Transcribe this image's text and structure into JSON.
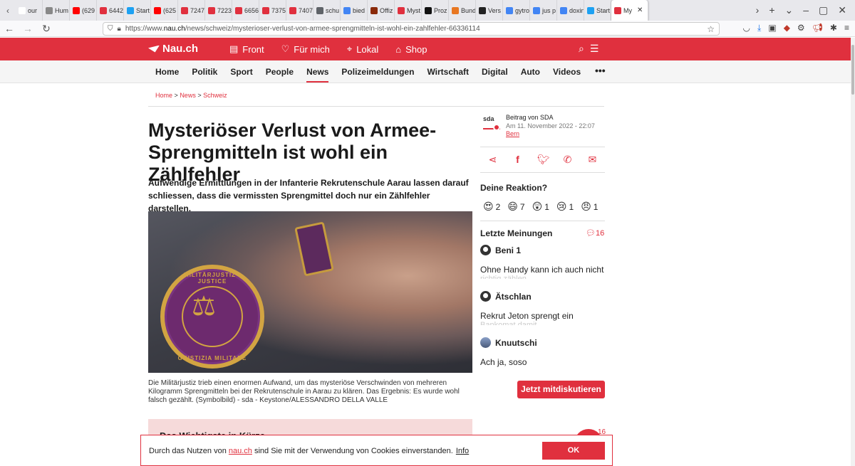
{
  "browser": {
    "tabs": [
      {
        "label": "our",
        "color": "#ffffff"
      },
      {
        "label": "Hum",
        "color": "#888888"
      },
      {
        "label": "(629",
        "color": "#ff0000"
      },
      {
        "label": "6442",
        "color": "#e0303e"
      },
      {
        "label": "Start",
        "color": "#1da1f2"
      },
      {
        "label": "(625",
        "color": "#ff0000"
      },
      {
        "label": "7247",
        "color": "#e0303e"
      },
      {
        "label": "7223",
        "color": "#e0303e"
      },
      {
        "label": "6656",
        "color": "#e0303e"
      },
      {
        "label": "7375",
        "color": "#e0303e"
      },
      {
        "label": "7407",
        "color": "#e0303e"
      },
      {
        "label": "schu",
        "color": "#5f6368"
      },
      {
        "label": "bied",
        "color": "#4285f4"
      },
      {
        "label": "Offiz",
        "color": "#8a2a0a"
      },
      {
        "label": "Myst",
        "color": "#e0303e"
      },
      {
        "label": "Proz",
        "color": "#111111"
      },
      {
        "label": "Bund",
        "color": "#e87722"
      },
      {
        "label": "Vers",
        "color": "#222222"
      },
      {
        "label": "gytro",
        "color": "#4285f4"
      },
      {
        "label": "jus p",
        "color": "#4285f4"
      },
      {
        "label": "doxin",
        "color": "#4285f4"
      },
      {
        "label": "Start",
        "color": "#1da1f2"
      }
    ],
    "active_tab": "My",
    "url_prefix": "https://www.",
    "url_host": "nau.ch",
    "url_path": "/news/schweiz/mysterioser-verlust-von-armee-sprengmitteln-ist-wohl-ein-zahlfehler-66336114"
  },
  "site": {
    "logo": "Nau.ch",
    "nav": [
      "Front",
      "Für mich",
      "Lokal",
      "Shop"
    ],
    "subnav": [
      "Home",
      "Politik",
      "Sport",
      "People",
      "News",
      "Polizeimeldungen",
      "Wirtschaft",
      "Digital",
      "Auto",
      "Videos"
    ],
    "active_subnav": "News",
    "brand_color": "#e0303e"
  },
  "article": {
    "breadcrumb": [
      "Home",
      "News",
      "Schweiz"
    ],
    "title": "Mysteriöser Verlust von Armee-Sprengmitteln ist wohl ein Zählfehler",
    "lead": "Aufwendige Ermittlungen in der Infanterie Rekrutenschule Aarau lassen darauf schliessen, dass die vermissten Sprengmittel doch nur ein Zählfehler darstellen.",
    "badge_top": "MILITÄRJUSTIZ · JUSTICE",
    "badge_bottom": "GIUSTIZIA MILITARE",
    "caption": "Die Militärjustiz trieb einen enormen Aufwand, um das mysteriöse Verschwinden von mehreren Kilogramm Sprengmitteln bei der Rekrutenschule in Aarau zu klären. Das Ergebnis: Es wurde wohl falsch gezählt. (Symbolbild) - sda - Keystone/ALESSANDRO DELLA VALLE",
    "infobox_heading": "Das Wichtigste in Kürze"
  },
  "sidebar": {
    "source_logo": "sda",
    "author": "Beitrag von SDA",
    "date": "Am 11. November 2022 - 22:07",
    "place": "Bern",
    "reaction_title": "Deine Reaktion?",
    "reactions": [
      {
        "face": "😍",
        "count": "2"
      },
      {
        "face": "😄",
        "count": "7"
      },
      {
        "face": "😲",
        "count": "1"
      },
      {
        "face": "😢",
        "count": "1"
      },
      {
        "face": "😠",
        "count": "1"
      }
    ],
    "opinions_title": "Letzte Meinungen",
    "opinions_count": "16",
    "comments": [
      {
        "user": "Beni 1",
        "text": "Ohne Handy kann ich auch nicht",
        "more": "richtig zählen"
      },
      {
        "user": "Ätschlan",
        "text": "Rekrut Jeton sprengt ein",
        "more": "Bankomat damit"
      },
      {
        "user": "Knuutschi",
        "text": "Ach ja, soso",
        "more": ""
      }
    ],
    "discuss_button": "Jetzt mitdiskutieren",
    "float_count": "16"
  },
  "cookie": {
    "text_before": "Durch das Nutzen von ",
    "link": "nau.ch",
    "text_after": " sind Sie mit der Verwendung von Cookies einverstanden.",
    "info": "Info",
    "ok": "OK"
  }
}
